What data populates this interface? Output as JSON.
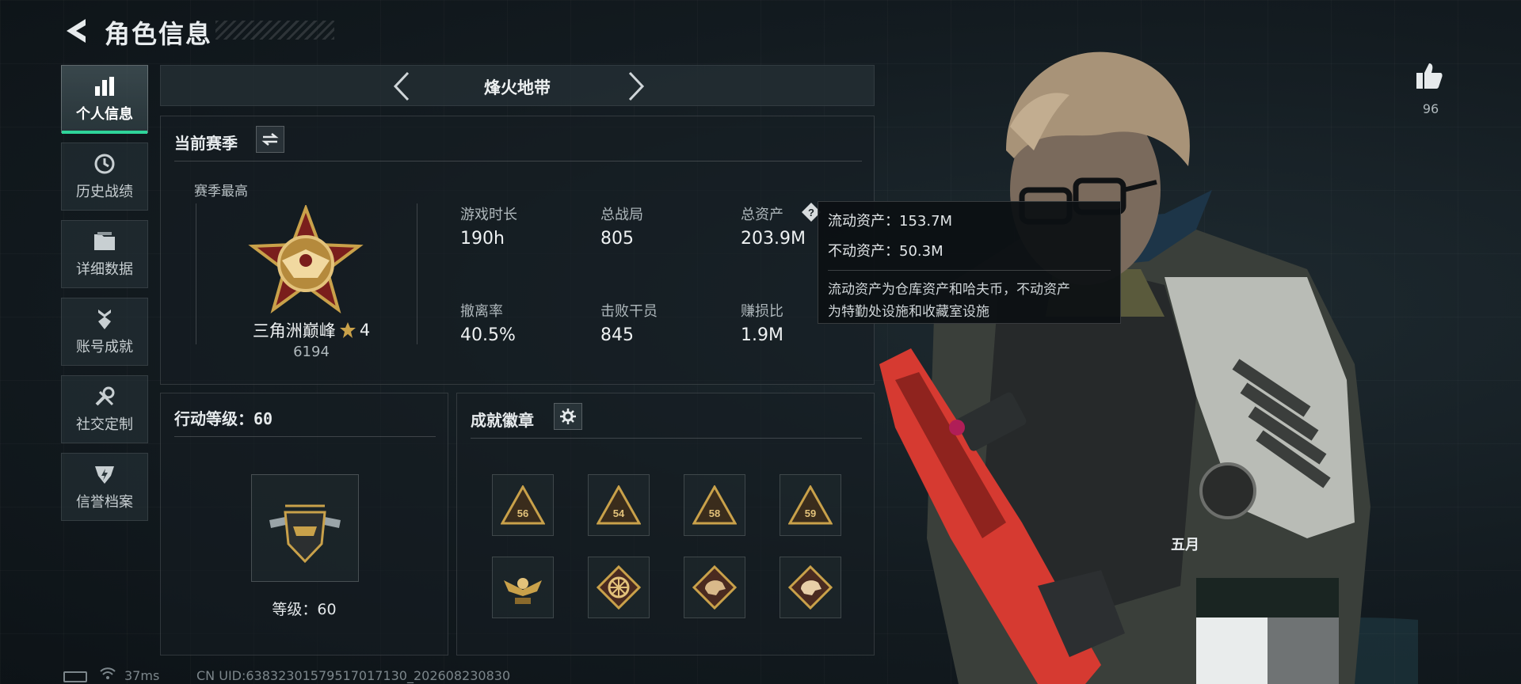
{
  "header": {
    "title": "角色信息"
  },
  "sidebar": {
    "items": [
      {
        "label": "个人信息",
        "icon": "bar-chart-icon",
        "active": true
      },
      {
        "label": "历史战绩",
        "icon": "clock-icon",
        "active": false
      },
      {
        "label": "详细数据",
        "icon": "folder-icon",
        "active": false
      },
      {
        "label": "账号成就",
        "icon": "medal-icon",
        "active": false
      },
      {
        "label": "社交定制",
        "icon": "wrench-icon",
        "active": false
      },
      {
        "label": "信誉档案",
        "icon": "shield-icon",
        "active": false
      }
    ]
  },
  "mode": {
    "title": "烽火地带"
  },
  "season": {
    "title": "当前赛季",
    "best_label": "赛季最高",
    "rank_name": "三角洲巅峰",
    "rank_stars": "4",
    "rank_score": "6194",
    "stats": [
      {
        "label": "游戏时长",
        "value": "190h"
      },
      {
        "label": "总战局",
        "value": "805"
      },
      {
        "label": "总资产",
        "value": "203.9M"
      },
      {
        "label": "撤离率",
        "value": "40.5%"
      },
      {
        "label": "击败干员",
        "value": "845"
      },
      {
        "label": "赚损比",
        "value": "1.9M"
      }
    ]
  },
  "tooltip": {
    "liquid": "流动资产：153.7M",
    "fixed": "不动资产：50.3M",
    "desc_line1": "流动资产为仓库资产和哈夫币，不动资产",
    "desc_line2": "为特勤处设施和收藏室设施"
  },
  "level": {
    "title": "行动等级：60",
    "label": "等级：60"
  },
  "achievements": {
    "title": "成就徽章",
    "badges": [
      "badge-56",
      "badge-54",
      "badge-58",
      "badge-59",
      "badge-eagle",
      "badge-wheel",
      "badge-dino-1",
      "badge-dino-2"
    ]
  },
  "likes": {
    "count": "96"
  },
  "character": {
    "name_partial": "五月"
  },
  "footer": {
    "ping": "37ms",
    "uid": "CN UID:63832301579517017130_202608230830"
  },
  "colors": {
    "accent": "#2fd49a",
    "gold": "#c9a14a",
    "weapon_red": "#e0322b"
  }
}
